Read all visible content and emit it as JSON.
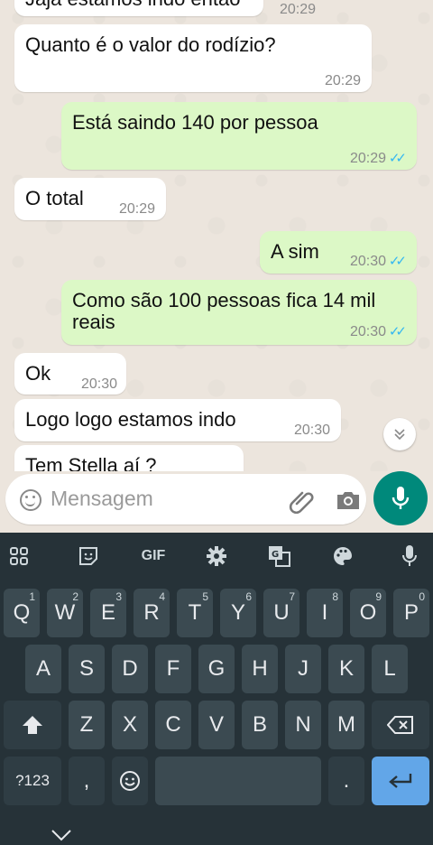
{
  "chat": {
    "messages": [
      {
        "dir": "in",
        "text": "Jaja estamos indo então",
        "time": "20:29"
      },
      {
        "dir": "in",
        "text": "Quanto é o valor do rodízio?",
        "time": "20:29"
      },
      {
        "dir": "out",
        "text": "Está saindo 140 por pessoa",
        "time": "20:29"
      },
      {
        "dir": "in",
        "text": "O total",
        "time": "20:29"
      },
      {
        "dir": "out",
        "text": "A sim",
        "time": "20:30"
      },
      {
        "dir": "out",
        "text": "Como são 100 pessoas fica 14 mil",
        "text2": "reais",
        "time": "20:30"
      },
      {
        "dir": "in",
        "text": "Ok",
        "time": "20:30"
      },
      {
        "dir": "in",
        "text": "Logo logo estamos indo",
        "time": "20:30"
      },
      {
        "dir": "in",
        "text": "Tem Stella aí ?",
        "time": ""
      }
    ]
  },
  "composer": {
    "placeholder": "Mensagem"
  },
  "keyboard": {
    "toolbar": {
      "gif_label": "GIF"
    },
    "row1": [
      {
        "letter": "Q",
        "num": "1"
      },
      {
        "letter": "W",
        "num": "2"
      },
      {
        "letter": "E",
        "num": "3"
      },
      {
        "letter": "R",
        "num": "4"
      },
      {
        "letter": "T",
        "num": "5"
      },
      {
        "letter": "Y",
        "num": "6"
      },
      {
        "letter": "U",
        "num": "7"
      },
      {
        "letter": "I",
        "num": "8"
      },
      {
        "letter": "O",
        "num": "9"
      },
      {
        "letter": "P",
        "num": "0"
      }
    ],
    "row2": [
      "A",
      "S",
      "D",
      "F",
      "G",
      "H",
      "J",
      "K",
      "L"
    ],
    "row3": [
      "Z",
      "X",
      "C",
      "V",
      "B",
      "N",
      "M"
    ],
    "symbols_label": "?123",
    "comma_label": ",",
    "period_label": "."
  },
  "colors": {
    "outgoing": "#dcf8c6",
    "incoming": "#ffffff",
    "accent": "#00897b",
    "ticks": "#34b7f1"
  }
}
